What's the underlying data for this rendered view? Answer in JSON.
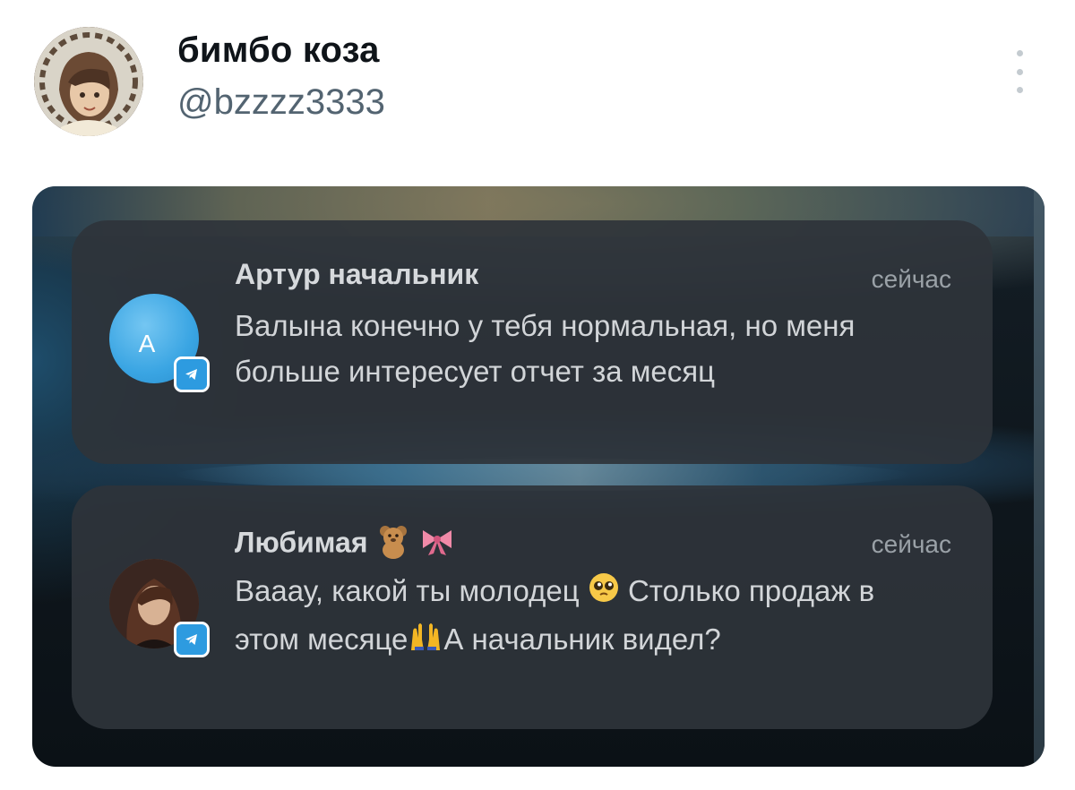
{
  "tweet": {
    "display_name": "бимбо коза",
    "handle": "@bzzzz3333"
  },
  "screenshot": {
    "notifications": [
      {
        "sender": "Артур начальник",
        "avatar_letter": "А",
        "time": "сейчас",
        "message": "Валына конечно у тебя нормальная, но меня больше интересует отчет за месяц",
        "app_icon": "telegram-icon"
      },
      {
        "sender": "Любимая",
        "sender_emojis": [
          "teddy-bear-emoji",
          "ribbon-emoji"
        ],
        "time": "сейчас",
        "message_part1": "Вааау, какой ты молодец",
        "message_part2": "Столько продаж в этом месяце",
        "message_part3": "А начальник видел?",
        "message_emojis": [
          "pleading-face-emoji",
          "raising-hands-emoji"
        ],
        "app_icon": "telegram-icon"
      }
    ]
  }
}
